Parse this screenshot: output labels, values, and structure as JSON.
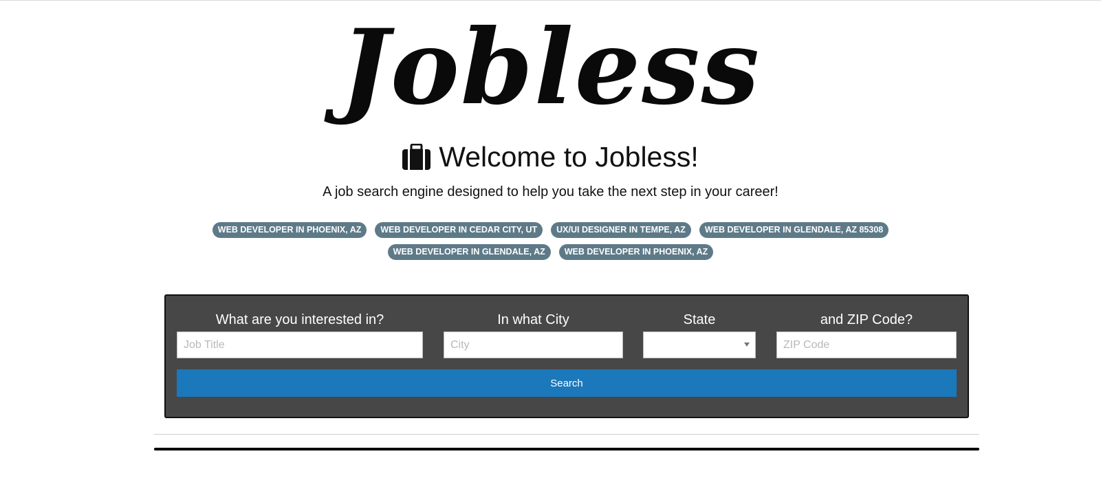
{
  "logo": {
    "text": "Jobless"
  },
  "welcome": {
    "title": "Welcome to Jobless!",
    "icon": "briefcase-icon",
    "tagline": "A job search engine designed to help you take the next step in your career!"
  },
  "recent_searches": [
    {
      "label": "WEB DEVELOPER IN PHOENIX, AZ"
    },
    {
      "label": "WEB DEVELOPER IN CEDAR CITY, UT"
    },
    {
      "label": "UX/UI DESIGNER IN TEMPE, AZ"
    },
    {
      "label": "WEB DEVELOPER IN GLENDALE, AZ 85308"
    },
    {
      "label": "WEB DEVELOPER IN GLENDALE, AZ"
    },
    {
      "label": "WEB DEVELOPER IN PHOENIX, AZ"
    }
  ],
  "search_form": {
    "job": {
      "label": "What are you interested in?",
      "placeholder": "Job Title",
      "value": ""
    },
    "city": {
      "label": "In what City",
      "placeholder": "City",
      "value": ""
    },
    "state": {
      "label": "State",
      "selected": ""
    },
    "zip": {
      "label": "and ZIP Code?",
      "placeholder": "ZIP Code",
      "value": ""
    },
    "search_label": "Search"
  },
  "colors": {
    "chip_bg": "#5e7a88",
    "panel_bg": "#474747",
    "search_button_bg": "#1b78bb"
  }
}
